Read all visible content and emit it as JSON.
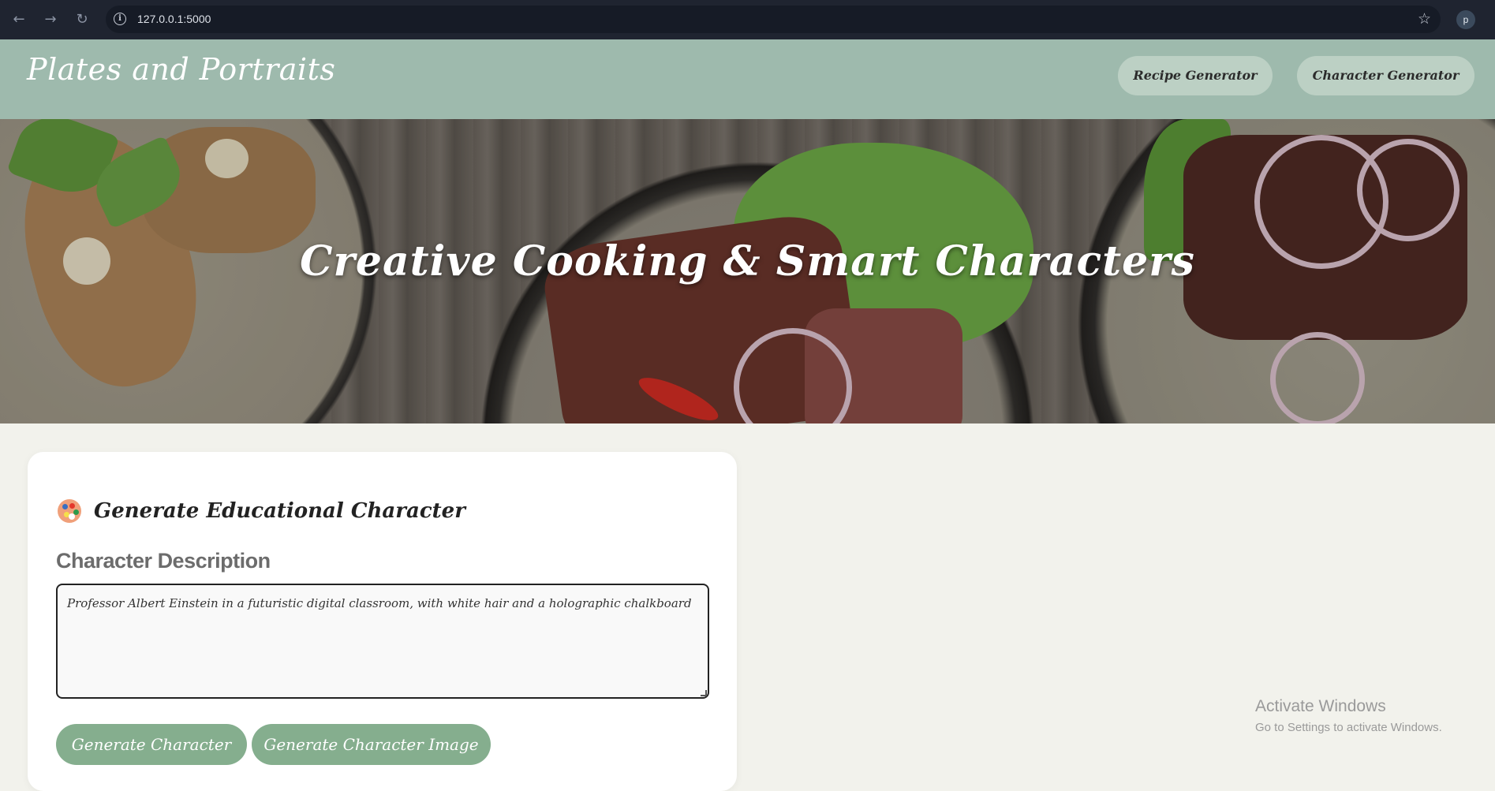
{
  "browser": {
    "url": "127.0.0.1:5000",
    "profile_initial": "p"
  },
  "header": {
    "brand": "Plates and Portraits",
    "nav": {
      "recipe_label": "Recipe Generator",
      "character_label": "Character Generator"
    }
  },
  "hero": {
    "title": "Creative Cooking & Smart Characters"
  },
  "card": {
    "title": "Generate Educational Character",
    "field_label": "Character Description",
    "description_value": "Professor Albert Einstein in a futuristic digital classroom, with white hair and a holographic chalkboard",
    "buttons": {
      "generate_character": "Generate Character",
      "generate_image": "Generate Character Image"
    }
  },
  "watermark": {
    "title": "Activate Windows",
    "subtitle": "Go to Settings to activate Windows."
  },
  "colors": {
    "header_bg": "#9ebaad",
    "nav_pill": "#bcd0c4",
    "button": "#85ae8e",
    "page_bg": "#f2f2ec"
  }
}
